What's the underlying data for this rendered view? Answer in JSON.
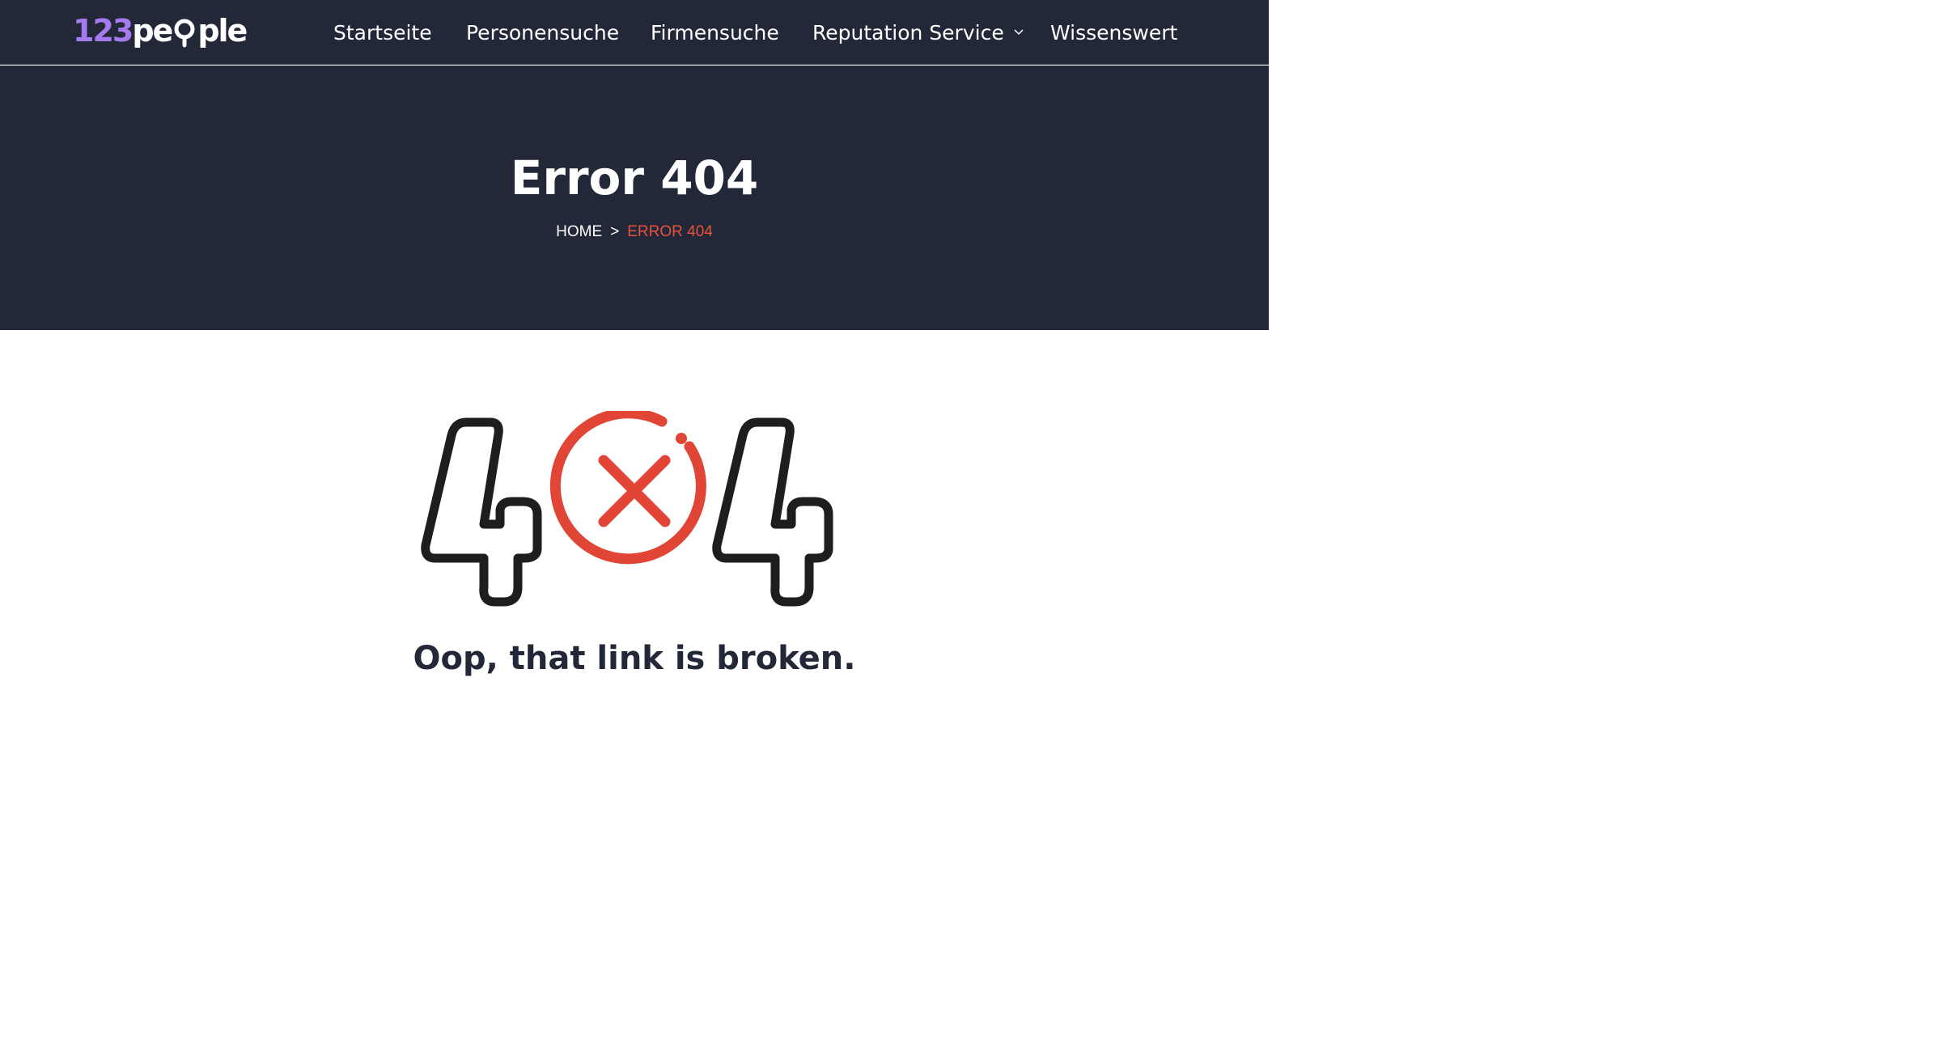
{
  "header": {
    "logo": {
      "numeric": "123",
      "word_prefix": "pe",
      "word_suffix": "ple",
      "accent_color": "#a77bf0",
      "icon": "magnifier-icon"
    },
    "nav": [
      {
        "label": "Startseite"
      },
      {
        "label": "Personensuche"
      },
      {
        "label": "Firmensuche"
      },
      {
        "label": "Reputation Service",
        "has_dropdown": true,
        "icon": "chevron-down-icon"
      },
      {
        "label": "Wissenswert"
      }
    ],
    "background_color": "#232838"
  },
  "hero": {
    "title": "Error 404",
    "breadcrumb": {
      "home": "HOME",
      "separator": ">",
      "current": "ERROR 404",
      "current_color": "#e5533d"
    }
  },
  "error_art": {
    "left_digit": "4",
    "right_digit": "4",
    "center_icon": "circle-x-icon",
    "digit_color": "#1e1e1e",
    "icon_color": "#e04535"
  },
  "message": "Oop, that link is broken."
}
